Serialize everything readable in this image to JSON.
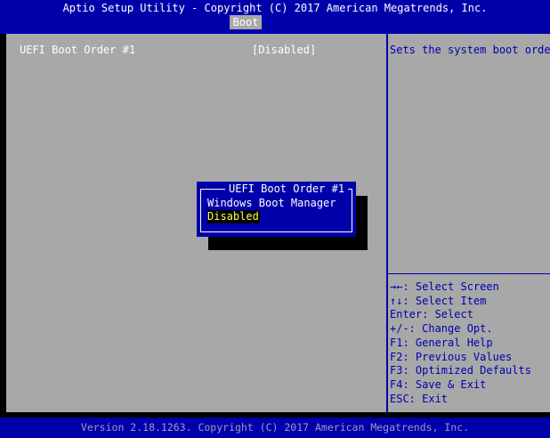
{
  "header": {
    "title": "Aptio Setup Utility - Copyright (C) 2017 American Megatrends, Inc.",
    "tabs": [
      {
        "label": "Boot",
        "active": true
      }
    ]
  },
  "settings": {
    "items": [
      {
        "label": "UEFI Boot Order #1",
        "value": "[Disabled]"
      }
    ]
  },
  "help": {
    "text": "Sets the system boot order",
    "keys": [
      "→←: Select Screen",
      "↑↓: Select Item",
      "Enter: Select",
      "+/-: Change Opt.",
      "F1: General Help",
      "F2: Previous Values",
      "F3: Optimized Defaults",
      "F4: Save & Exit",
      "ESC: Exit"
    ]
  },
  "popup": {
    "title": "UEFI Boot Order #1",
    "options": [
      {
        "label": "Windows Boot Manager",
        "selected": false
      },
      {
        "label": "Disabled",
        "selected": true
      }
    ]
  },
  "footer": {
    "text": "Version 2.18.1263. Copyright (C) 2017 American Megatrends, Inc."
  },
  "colors": {
    "bios_blue": "#0000aa",
    "panel_gray": "#a8a8a8",
    "highlight_text": "#ffff55",
    "text_white": "#ffffff"
  }
}
